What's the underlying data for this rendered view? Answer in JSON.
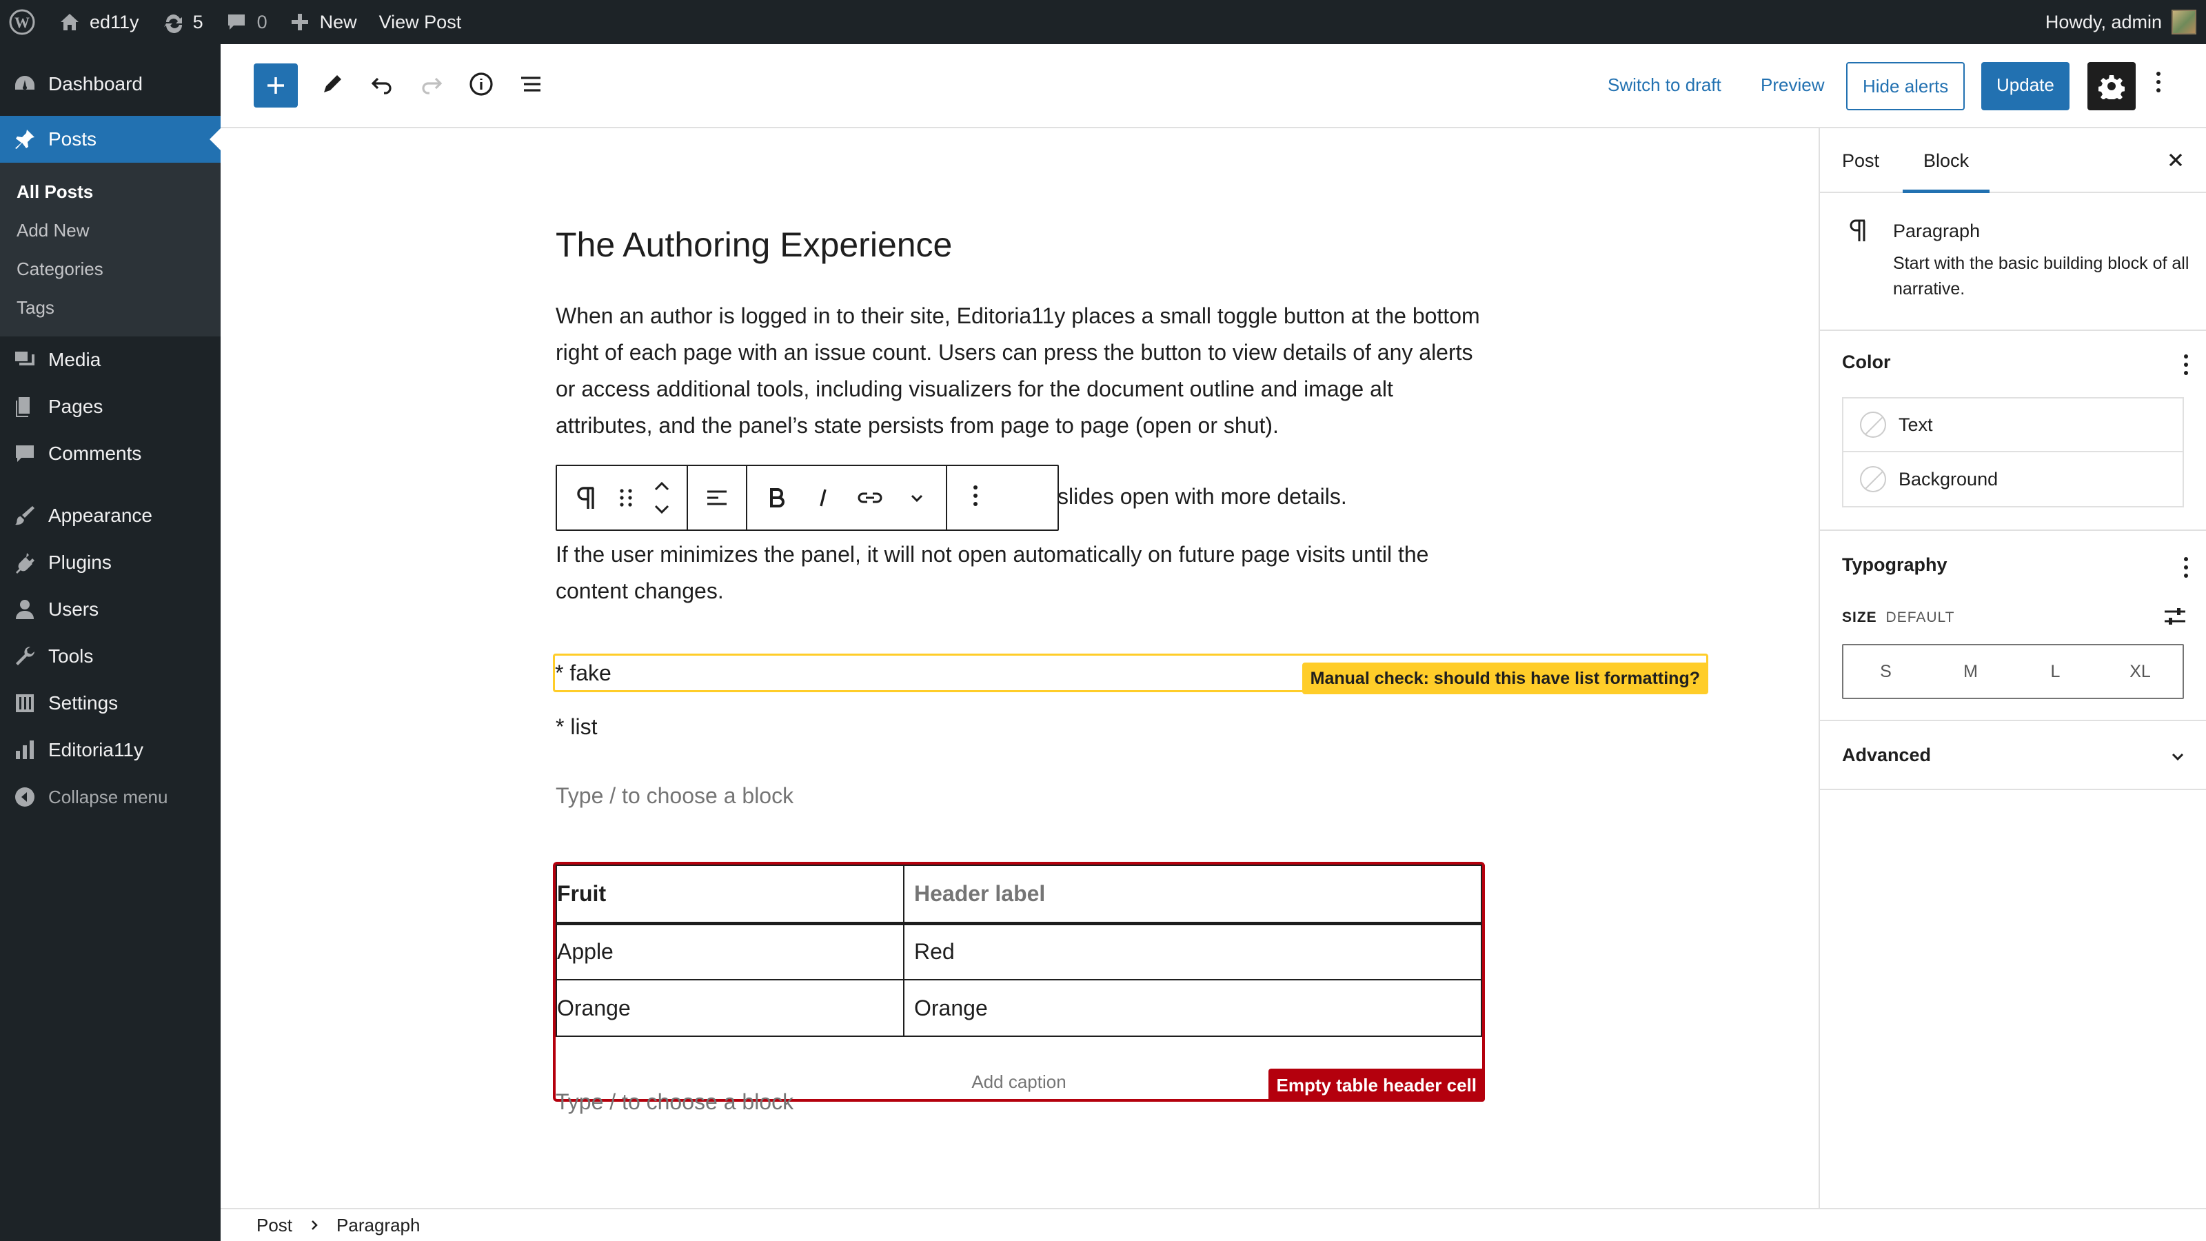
{
  "admin_bar": {
    "site_name": "ed11y",
    "updates_count": "5",
    "comments_count": "0",
    "new_label": "New",
    "view_post_label": "View Post",
    "howdy": "Howdy, admin"
  },
  "sidebar": {
    "dashboard": "Dashboard",
    "posts": "Posts",
    "submenu": [
      "All Posts",
      "Add New",
      "Categories",
      "Tags"
    ],
    "media": "Media",
    "pages": "Pages",
    "comments": "Comments",
    "appearance": "Appearance",
    "plugins": "Plugins",
    "users": "Users",
    "tools": "Tools",
    "settings": "Settings",
    "editoria11y": "Editoria11y",
    "collapse": "Collapse menu"
  },
  "header": {
    "switch_to_draft": "Switch to draft",
    "preview": "Preview",
    "hide_alerts": "Hide alerts",
    "update": "Update"
  },
  "editor": {
    "title": "The Authoring Experience",
    "paragraph1": "When an author is logged in to their site, Editoria11y places a small toggle button at the bottom right of each page with an issue count. Users can press the button to view details of any alerts or access additional tools, including visualizers for the document outline and image alt attributes, and the panel’s state persists from page to page (open or shut).",
    "paragraph2_visible": "slides open with more details.",
    "paragraph3": "If the user minimizes the panel, it will not open automatically on future page visits until the content changes.",
    "fake_list_1": "* fake",
    "fake_list_2": "* list",
    "manual_check_alert": "Manual check: should this have list formatting?",
    "placeholder": "Type / to choose a block",
    "table": {
      "headers": [
        "Fruit",
        "Header label"
      ],
      "rows": [
        [
          "Apple",
          "Red"
        ],
        [
          "Orange",
          "Orange"
        ]
      ],
      "caption_placeholder": "Add caption",
      "alert": "Empty table header cell"
    }
  },
  "panel": {
    "tab_post": "Post",
    "tab_block": "Block",
    "block_name": "Paragraph",
    "block_description": "Start with the basic building block of all narrative.",
    "color_title": "Color",
    "color_text": "Text",
    "color_background": "Background",
    "typography_title": "Typography",
    "size_label": "SIZE",
    "size_value": "DEFAULT",
    "sizes": [
      "S",
      "M",
      "L",
      "XL"
    ],
    "advanced_title": "Advanced"
  },
  "footer": {
    "crumb_post": "Post",
    "crumb_paragraph": "Paragraph"
  },
  "colors": {
    "admin_dark": "#1d2327",
    "accent": "#2271b1",
    "alert_yellow": "#ffcd29",
    "alert_red": "#b4000d"
  }
}
